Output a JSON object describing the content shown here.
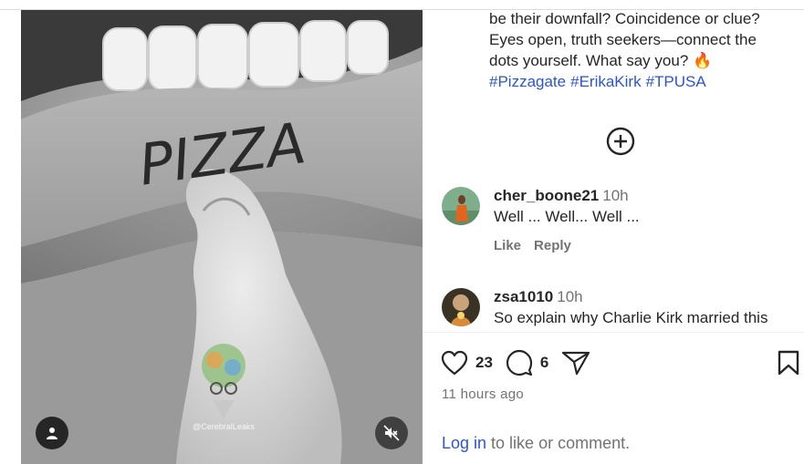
{
  "caption": {
    "lines": [
      "be their downfall? Coincidence or clue?",
      "Eyes open, truth seekers—connect the",
      "dots yourself. What say you? 🔥"
    ],
    "hashtags": [
      "#Pizzagate",
      "#ErikaKirk",
      "#TPUSA"
    ]
  },
  "media": {
    "lip_text": "PIZZA",
    "watermark": "@CerebralLeaks"
  },
  "comments": [
    {
      "username": "cher_boone21",
      "time": "10h",
      "text": "Well ... Well... Well ...",
      "like_label": "Like",
      "reply_label": "Reply"
    },
    {
      "username": "zsa1010",
      "time": "10h",
      "text": "So explain why Charlie Kirk married this"
    }
  ],
  "actions": {
    "likes": "23",
    "comments": "6",
    "posted_ago": "11 hours ago"
  },
  "footer": {
    "login_link": "Log in",
    "login_suffix": " to like or comment."
  },
  "icons": {
    "user_tag": "person-icon",
    "mute": "speaker-muted-icon",
    "add": "plus-circle-icon",
    "like": "heart-icon",
    "comment": "speech-bubble-icon",
    "share": "paper-plane-icon",
    "save": "bookmark-icon"
  },
  "colors": {
    "link": "#2b55d3",
    "muted_text": "#737373",
    "primary_text": "#262626"
  }
}
